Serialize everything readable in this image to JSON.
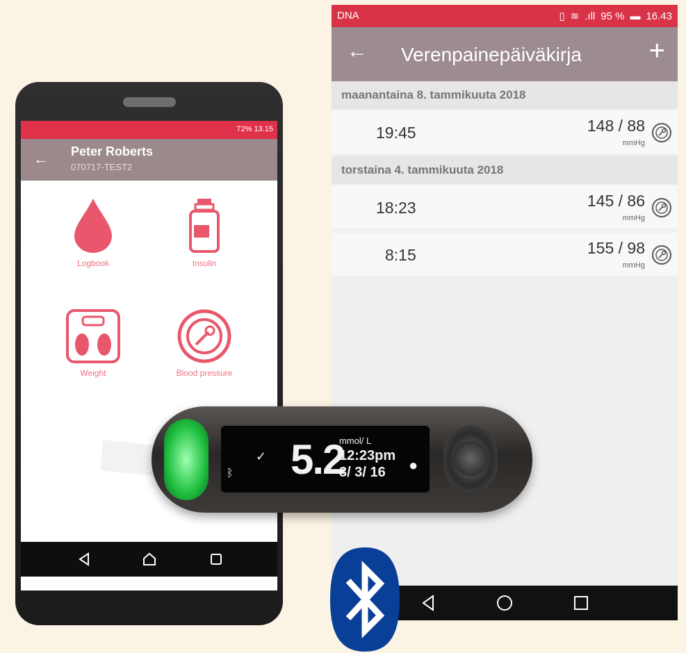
{
  "right_app": {
    "status": {
      "carrier": "DNA",
      "signal_text": ".ıll",
      "battery_percent": "95 %",
      "time": "16.43"
    },
    "appbar": {
      "back_icon": "back-arrow-icon",
      "title": "Verenpainepäiväkirja",
      "add_icon": "plus-icon"
    },
    "days": [
      {
        "header": "maanantaina 8. tammikuuta 2018",
        "entries": [
          {
            "time": "19:45",
            "value": "148 / 88",
            "unit": "mmHg",
            "icon": "blood-pressure-gauge-icon"
          }
        ]
      },
      {
        "header": "torstaina 4. tammikuuta 2018",
        "entries": [
          {
            "time": "18:23",
            "value": "145 / 86",
            "unit": "mmHg",
            "icon": "blood-pressure-gauge-icon"
          },
          {
            "time": "8:15",
            "value": "155 / 98",
            "unit": "mmHg",
            "icon": "blood-pressure-gauge-icon"
          }
        ]
      }
    ],
    "nav": [
      "back-triangle-icon",
      "home-circle-icon",
      "recents-square-icon"
    ]
  },
  "left_phone": {
    "status": {
      "text": "72%  13.15"
    },
    "appbar": {
      "name": "Peter Roberts",
      "code": "070717-TEST2"
    },
    "tiles": [
      {
        "label": "Logbook",
        "icon": "blood-drop-icon"
      },
      {
        "label": "Insulin",
        "icon": "insulin-vial-icon"
      },
      {
        "label": "Weight",
        "icon": "scale-icon"
      },
      {
        "label": "Blood pressure",
        "icon": "blood-pressure-gauge-icon"
      }
    ],
    "nav": [
      "back-triangle-icon",
      "home-icon",
      "recents-square-icon"
    ]
  },
  "meter": {
    "reading": "5.2",
    "unit": "mmol/ L",
    "time": "12:23pm",
    "date": "3/ 3/ 16"
  },
  "colors": {
    "status_red": "#d83347",
    "appbar_gray": "#9c8c8f",
    "accent_pink": "#ef6f83",
    "bluetooth_blue": "#0a3f97"
  }
}
